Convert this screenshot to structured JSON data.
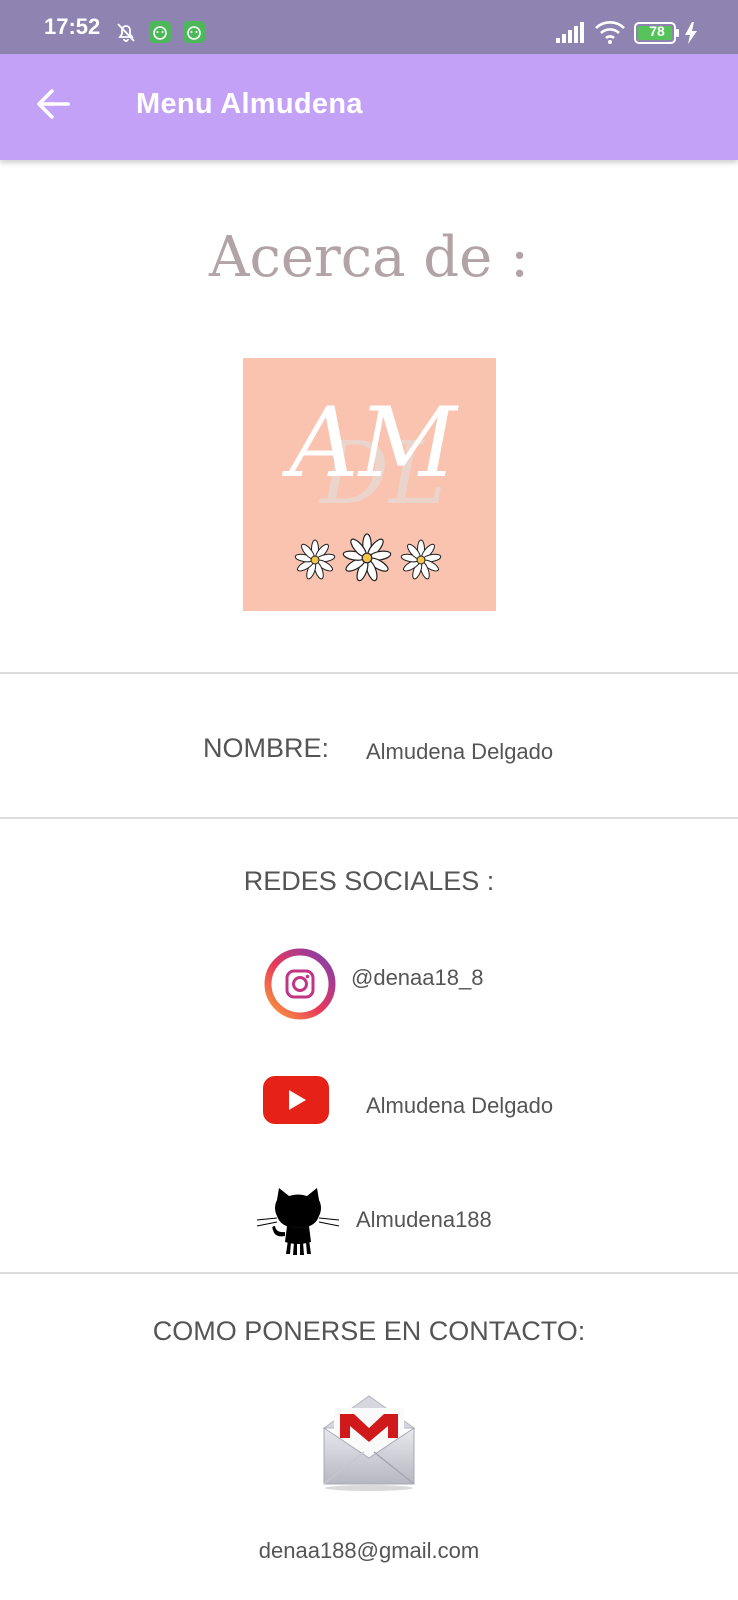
{
  "status_bar": {
    "time": "17:52",
    "battery": "78"
  },
  "app_bar": {
    "title": "Menu Almudena"
  },
  "about": {
    "heading": "Acerca de :",
    "logo_text": "AM",
    "logo_monogram": "DL"
  },
  "name_section": {
    "label": "NOMBRE:",
    "value": "Almudena Delgado"
  },
  "social": {
    "heading": "REDES SOCIALES :",
    "items": [
      {
        "network": "instagram",
        "handle": "@denaa18_8",
        "icon": "instagram-icon"
      },
      {
        "network": "youtube",
        "handle": "Almudena Delgado",
        "icon": "youtube-icon"
      },
      {
        "network": "github",
        "handle": "Almudena188",
        "icon": "github-octocat-icon"
      }
    ]
  },
  "contact": {
    "heading": "COMO PONERSE EN CONTACTO:",
    "email": "denaa188@gmail.com",
    "icon": "gmail-icon"
  },
  "colors": {
    "status_bar": "#8f84b1",
    "app_bar": "#c3a1f7",
    "logo_bg": "#f9c3b0",
    "heading": "#b2a3a6"
  }
}
